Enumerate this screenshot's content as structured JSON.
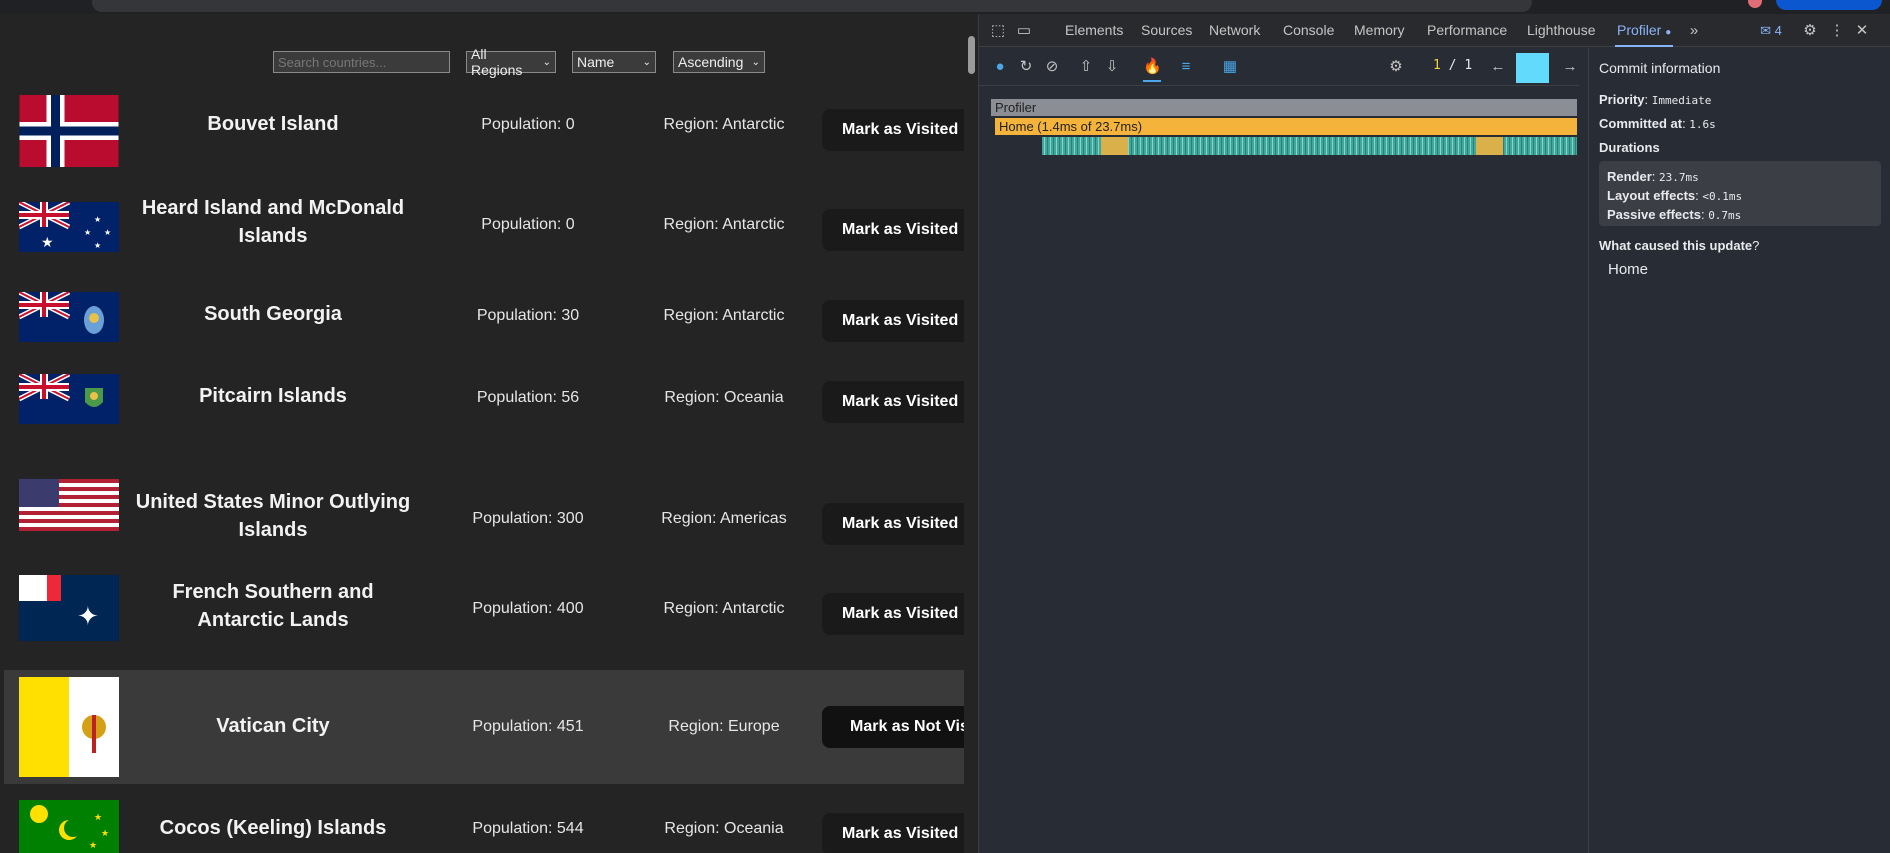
{
  "app": {
    "search_placeholder": "Search countries...",
    "region_filter": "All Regions",
    "sort_field": "Name",
    "sort_order": "Ascending",
    "countries": [
      {
        "name": "Bouvet Island",
        "population": "Population: 0",
        "region": "Region: Antarctic",
        "button": "Mark as Visited"
      },
      {
        "name": "Heard Island and McDonald Islands",
        "population": "Population: 0",
        "region": "Region: Antarctic",
        "button": "Mark as Visited"
      },
      {
        "name": "South Georgia",
        "population": "Population: 30",
        "region": "Region: Antarctic",
        "button": "Mark as Visited"
      },
      {
        "name": "Pitcairn Islands",
        "population": "Population: 56",
        "region": "Region: Oceania",
        "button": "Mark as Visited"
      },
      {
        "name": "United States Minor Outlying Islands",
        "population": "Population: 300",
        "region": "Region: Americas",
        "button": "Mark as Visited"
      },
      {
        "name": "French Southern and Antarctic Lands",
        "population": "Population: 400",
        "region": "Region: Antarctic",
        "button": "Mark as Visited"
      },
      {
        "name": "Vatican City",
        "population": "Population: 451",
        "region": "Region: Europe",
        "button": "Mark as Not Visited"
      },
      {
        "name": "Cocos (Keeling) Islands",
        "population": "Population: 544",
        "region": "Region: Oceania",
        "button": "Mark as Visited"
      }
    ]
  },
  "devtools": {
    "tabs": [
      "Elements",
      "Sources",
      "Network",
      "Console",
      "Memory",
      "Performance",
      "Lighthouse",
      "Profiler"
    ],
    "active_tab": "Profiler",
    "issues_count": "4",
    "commit_current": "1",
    "commit_sep": "/",
    "commit_total": "1",
    "flame_root": "Profiler",
    "flame_home": "Home (1.4ms of 23.7ms)",
    "side": {
      "title": "Commit information",
      "priority_label": "Priority",
      "priority_value": "Immediate",
      "committed_label": "Committed at",
      "committed_value": "1.6s",
      "durations_label": "Durations",
      "render_label": "Render",
      "render_value": "23.7ms",
      "layout_label": "Layout effects",
      "layout_value": "<0.1ms",
      "passive_label": "Passive effects",
      "passive_value": "0.7ms",
      "cause_label": "What caused this update",
      "cause_q": "?",
      "cause_value": "Home"
    }
  },
  "colors": {
    "accent": "#8ab4f8",
    "flame_home": "#f4b43c",
    "flame_child": "#3fa79b",
    "commit_bar": "#61dafb"
  }
}
